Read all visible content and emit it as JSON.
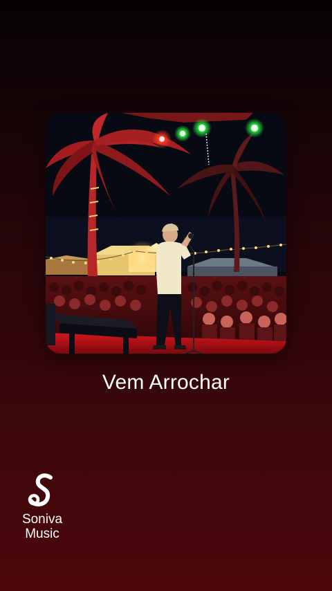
{
  "track": {
    "title": "Vem Arrochar"
  },
  "brand": {
    "line1": "Soniva",
    "line2": "Music",
    "logo_icon": "soniva-s-logo-icon"
  },
  "cover": {
    "image": "album-cover-singer-on-stage-night-concert",
    "accent_red": "#c8151c",
    "light_green": "#3cff5a"
  }
}
